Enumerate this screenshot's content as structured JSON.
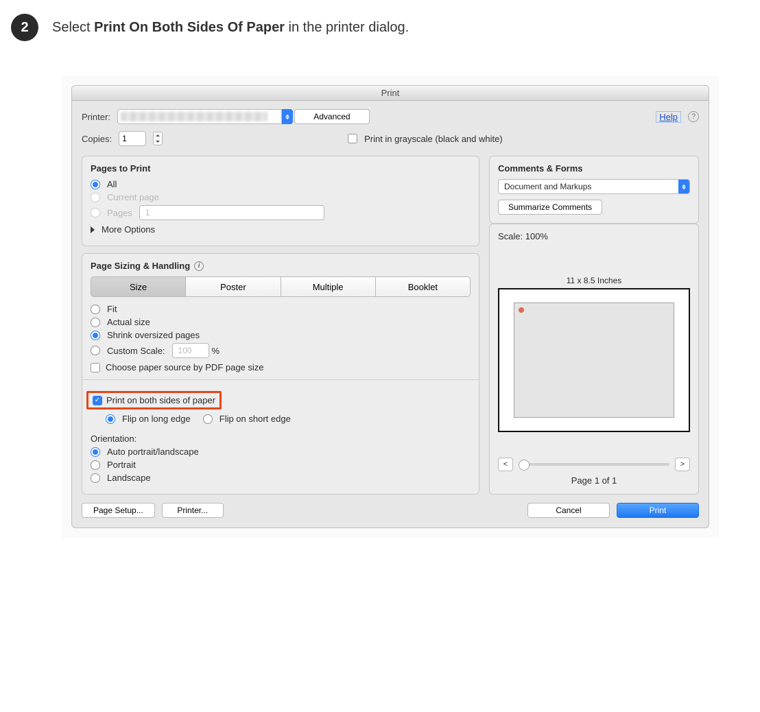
{
  "instruction": {
    "step_number": "2",
    "prefix": "Select ",
    "bold": "Print On Both Sides Of Paper",
    "suffix": " in the printer dialog."
  },
  "dialog": {
    "title": "Print",
    "printer_label": "Printer:",
    "advanced_btn": "Advanced",
    "help_link": "Help",
    "copies_label": "Copies:",
    "copies_value": "1",
    "grayscale_label": "Print in grayscale (black and white)"
  },
  "pages_panel": {
    "title": "Pages to Print",
    "opt_all": "All",
    "opt_current": "Current page",
    "opt_pages": "Pages",
    "pages_value": "1",
    "more_options": "More Options"
  },
  "sizing_panel": {
    "title": "Page Sizing & Handling",
    "tab_size": "Size",
    "tab_poster": "Poster",
    "tab_multiple": "Multiple",
    "tab_booklet": "Booklet",
    "opt_fit": "Fit",
    "opt_actual": "Actual size",
    "opt_shrink": "Shrink oversized pages",
    "opt_custom": "Custom Scale:",
    "custom_value": "100",
    "percent": "%",
    "paper_source": "Choose paper source by PDF page size",
    "both_sides": "Print on both sides of paper",
    "flip_long": "Flip on long edge",
    "flip_short": "Flip on short edge",
    "orientation_title": "Orientation:",
    "orient_auto": "Auto portrait/landscape",
    "orient_portrait": "Portrait",
    "orient_landscape": "Landscape"
  },
  "comments_panel": {
    "title": "Comments & Forms",
    "dropdown_value": "Document and Markups",
    "summarize_btn": "Summarize Comments"
  },
  "preview": {
    "scale_label": "Scale: 100%",
    "dimensions": "11 x 8.5 Inches",
    "page_label": "Page 1 of 1"
  },
  "footer": {
    "page_setup": "Page Setup...",
    "printer_btn": "Printer...",
    "cancel": "Cancel",
    "print": "Print"
  }
}
